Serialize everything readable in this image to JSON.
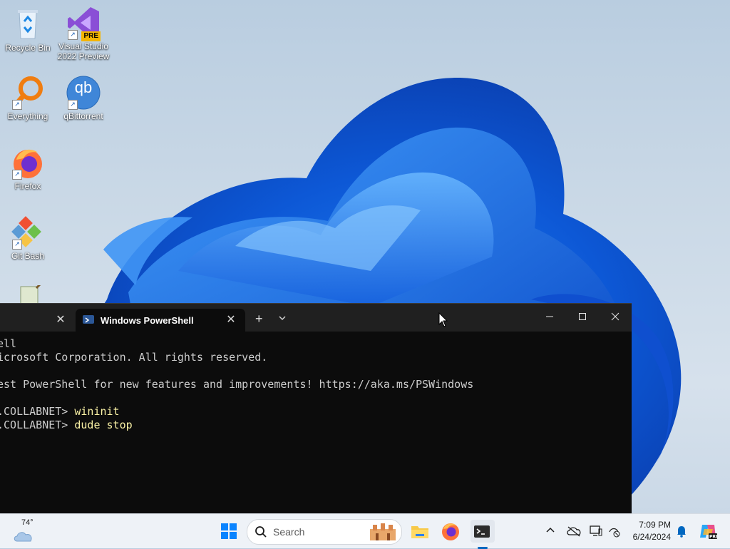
{
  "desktop": {
    "icons": [
      {
        "label": "Recycle Bin"
      },
      {
        "label": "Visual Studio\n2022 Preview",
        "badge": "PRE"
      },
      {
        "label": "Everything"
      },
      {
        "label": "qBittorrent",
        "glyph": "qb"
      },
      {
        "label": "Firefox"
      },
      {
        "label": "Git Bash"
      }
    ]
  },
  "terminal": {
    "active_tab_title": "Windows PowerShell",
    "new_tab_symbol": "+",
    "dropdown_symbol": "⌄",
    "lines": [
      {
        "prompt": "ell",
        "command": ""
      },
      {
        "prompt": "icrosoft Corporation. All rights reserved.",
        "command": ""
      },
      {
        "prompt": "",
        "command": ""
      },
      {
        "prompt": "est PowerShell for new features and improvements! https://aka.ms/PSWindows",
        "command": ""
      },
      {
        "prompt": "",
        "command": ""
      },
      {
        "prompt": ".COLLABNET> ",
        "command": "wininit"
      },
      {
        "prompt": ".COLLABNET> ",
        "command": "dude stop"
      }
    ]
  },
  "taskbar": {
    "weather_temp": "74°",
    "search_placeholder": "Search",
    "time": "7:09 PM",
    "date": "6/24/2024"
  },
  "colors": {
    "accent": "#0067c0",
    "terminal_bg": "#0c0c0c",
    "command_text": "#f9f1a5"
  }
}
